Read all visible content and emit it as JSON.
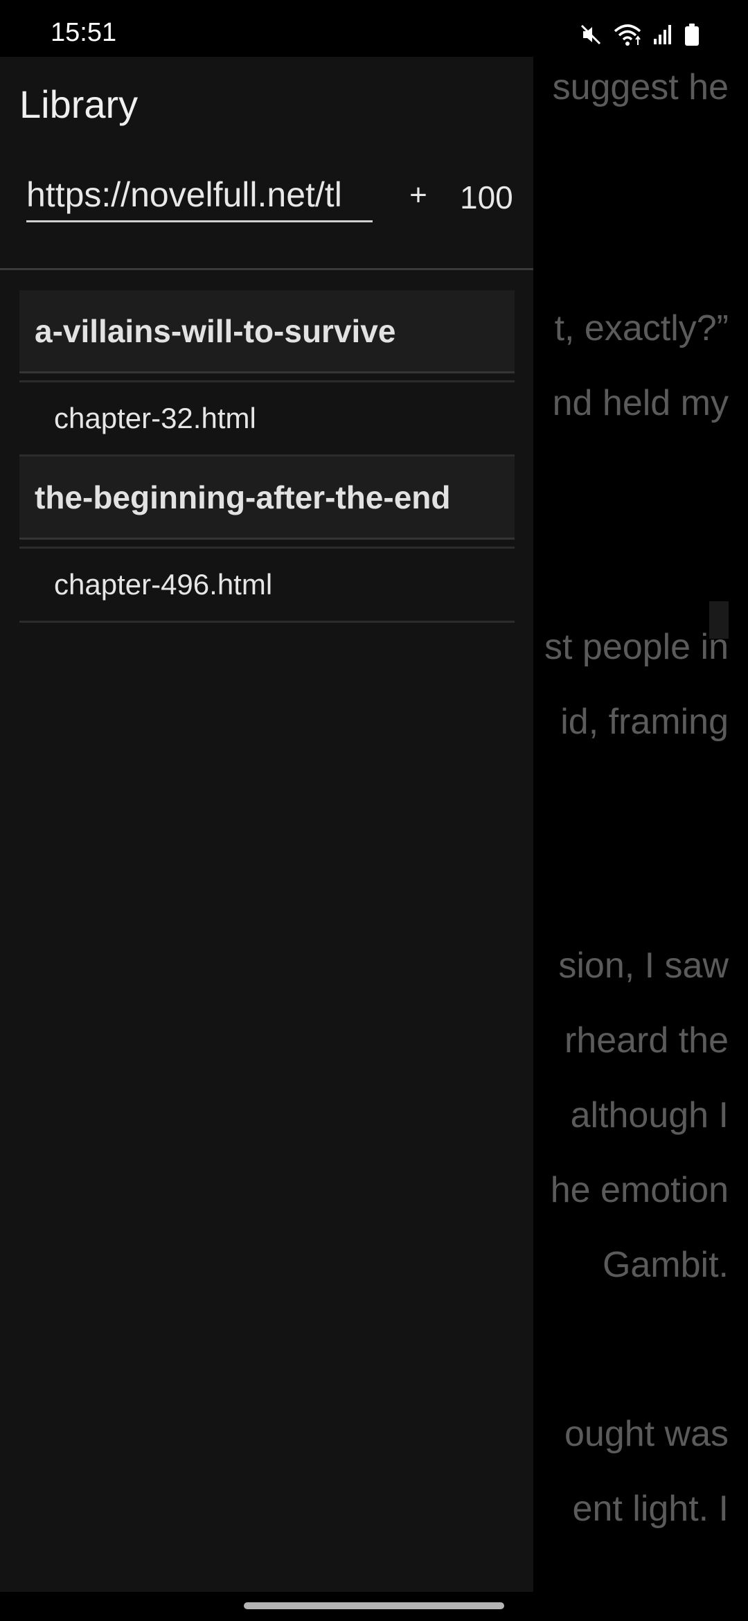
{
  "status_bar": {
    "time": "15:51",
    "icons": [
      "mute-icon",
      "wifi-icon",
      "signal-icon",
      "battery-icon"
    ]
  },
  "reader": {
    "lines": [
      "suggest he",
      "t, exactly?”",
      "nd held my",
      "st people in",
      "id, framing",
      "sion, I saw",
      "rheard the",
      "although I",
      "he emotion",
      "Gambit.",
      "ought was",
      "ent light. I"
    ]
  },
  "drawer": {
    "title": "Library",
    "url_input": {
      "value": "https://novelfull.net/tl",
      "placeholder": ""
    },
    "add_label": "+",
    "count": "100",
    "books": [
      {
        "title": "a-villains-will-to-survive",
        "chapters": [
          "chapter-32.html"
        ]
      },
      {
        "title": "the-beginning-after-the-end",
        "chapters": [
          "chapter-496.html"
        ]
      }
    ]
  },
  "colors": {
    "drawer_bg": "#131313",
    "book_header_bg": "#1d1d1d",
    "reader_text": "#5b5b5b"
  }
}
